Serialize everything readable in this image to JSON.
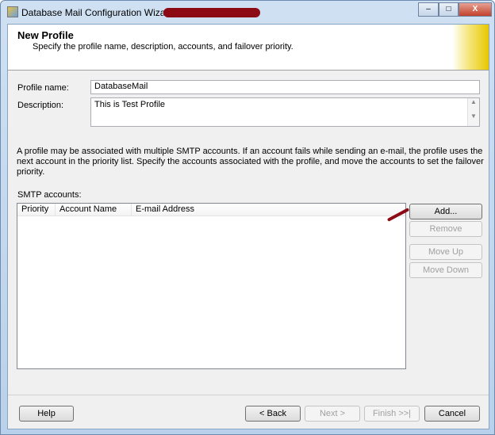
{
  "window": {
    "title": "Database Mail Configuration Wizard",
    "minimize": "–",
    "maximize": "□",
    "close": "X"
  },
  "header": {
    "title": "New Profile",
    "subtitle": "Specify the profile name, description, accounts, and failover priority."
  },
  "form": {
    "profile_name_label": "Profile name:",
    "profile_name_value": "DatabaseMail",
    "description_label": "Description:",
    "description_value": "This is Test Profile"
  },
  "info": "A profile may be associated with multiple SMTP accounts. If an account fails while sending an e-mail, the profile uses the next account in the priority list. Specify the accounts associated with the profile, and move the accounts to set the failover priority.",
  "smtp": {
    "label": "SMTP accounts:",
    "columns": [
      "Priority",
      "Account Name",
      "E-mail Address"
    ],
    "rows": []
  },
  "side_buttons": {
    "add": "Add...",
    "remove": "Remove",
    "move_up": "Move Up",
    "move_down": "Move Down"
  },
  "footer": {
    "help": "Help",
    "back": "< Back",
    "next": "Next >",
    "finish": "Finish >>|",
    "cancel": "Cancel"
  }
}
